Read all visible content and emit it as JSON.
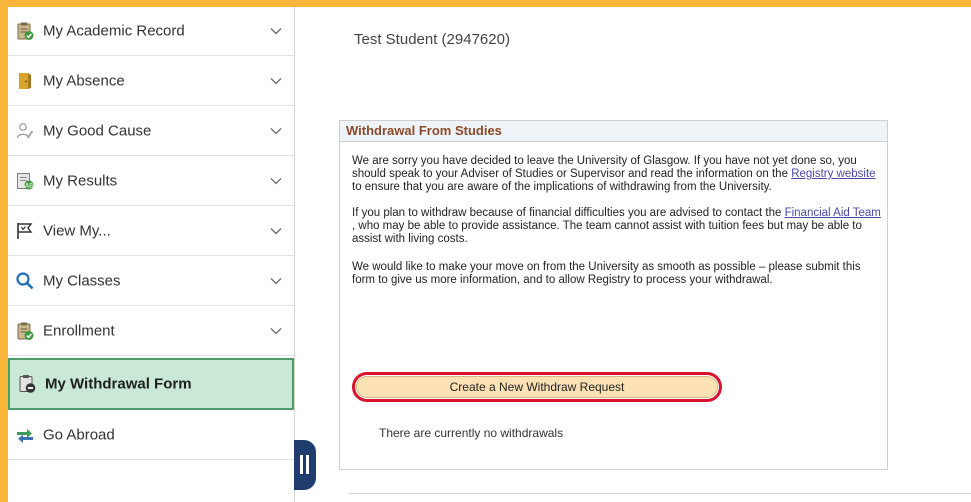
{
  "sidebar": {
    "items": [
      {
        "label": "My Academic Record",
        "icon": "clipboard-check-icon"
      },
      {
        "label": "My Absence",
        "icon": "door-icon"
      },
      {
        "label": "My Good Cause",
        "icon": "person-edit-icon"
      },
      {
        "label": "My Results",
        "icon": "results-icon"
      },
      {
        "label": "View My...",
        "icon": "flag-icon"
      },
      {
        "label": "My Classes",
        "icon": "search-icon"
      },
      {
        "label": "Enrollment",
        "icon": "clipboard-check-icon"
      },
      {
        "label": "My Withdrawal Form",
        "icon": "withdrawal-form-icon",
        "active": true
      },
      {
        "label": "Go Abroad",
        "icon": "exchange-arrows-icon"
      }
    ]
  },
  "student": {
    "name": "Test Student (2947620)"
  },
  "panel": {
    "title": "Withdrawal From Studies",
    "p1": {
      "before": "We are sorry you have decided to leave the University of Glasgow. If you have not yet done so, you should speak to your Adviser of Studies or Supervisor and read the information on the ",
      "link": "Registry website ",
      "after": "to ensure that you are aware of the implications of withdrawing from the University."
    },
    "p2": {
      "before": "If you plan to withdraw because of financial difficulties you are advised to contact the ",
      "link": "Financial Aid Team ",
      "after": ", who may be able to provide assistance. The team cannot assist with tuition fees but may be able to assist with living costs."
    },
    "p3": "We would like to make your move on from the University as smooth as possible – please submit this form to give us more information, and to allow Registry to process your withdrawal.",
    "button_label": "Create a New Withdraw Request",
    "empty_text": "There are currently no withdrawals"
  },
  "colors": {
    "frame_border": "#f9b43a",
    "active_bg": "#c9e8d6",
    "active_border": "#4f9a6b",
    "panel_title": "#8a4b2b",
    "highlight_outline": "#d8112d",
    "button_bg": "#fbe1b4",
    "handle": "#1f3c6e"
  }
}
